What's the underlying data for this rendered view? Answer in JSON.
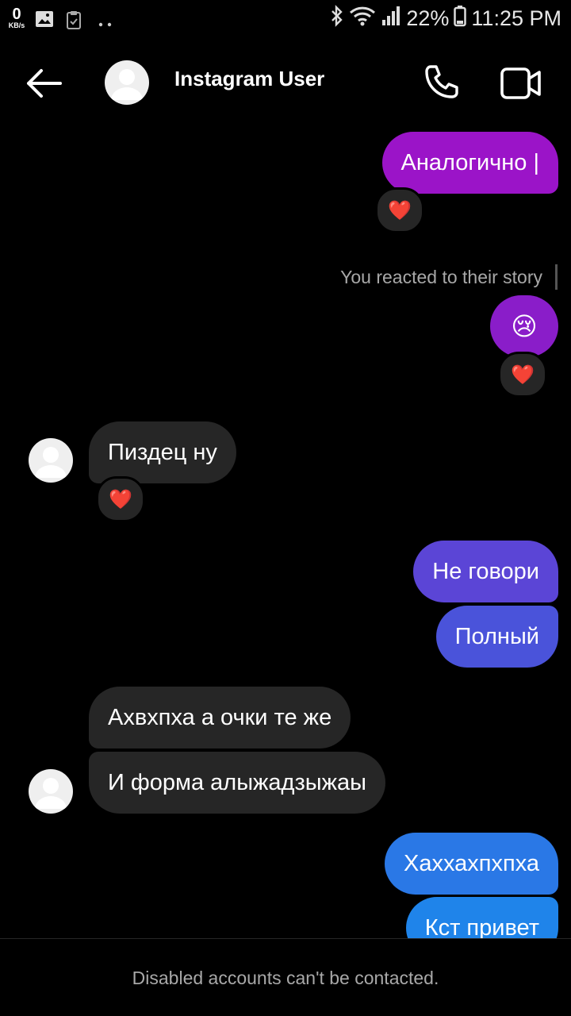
{
  "status_bar": {
    "net_speed": "0",
    "net_unit": "KB/s",
    "battery": "22%",
    "time": "11:25 PM",
    "icons": [
      "image-icon",
      "clipboard-icon",
      "dots-icon",
      "bluetooth-icon",
      "wifi-icon",
      "signal-icon",
      "battery-icon"
    ]
  },
  "header": {
    "title": "Instagram User",
    "icons": [
      "back-arrow-icon",
      "avatar",
      "phone-icon",
      "video-camera-icon"
    ]
  },
  "messages": [
    {
      "from": "me",
      "text": "Аналогично |",
      "color": "#9b14c8",
      "reaction": "❤️"
    },
    {
      "from": "system",
      "text": "You reacted to their story"
    },
    {
      "from": "me",
      "text": "😢",
      "color": "#8a1dc9",
      "reaction": "❤️"
    },
    {
      "from": "them",
      "text": "Пиздец ну",
      "reaction": "❤️"
    },
    {
      "from": "me",
      "text": "Не говори",
      "color": "#5b45d6"
    },
    {
      "from": "me",
      "text": "Полный",
      "color": "#4a53da"
    },
    {
      "from": "them",
      "text": "Ахвхпха а очки те же"
    },
    {
      "from": "them",
      "text": "И форма алыжадзыжаы"
    },
    {
      "from": "me",
      "text": "Хаххахпхпха",
      "color": "#2a78e6"
    },
    {
      "from": "me",
      "text": "Кст привет",
      "color": "#1f84ea"
    }
  ],
  "footer": {
    "text": "Disabled accounts can't be contacted."
  }
}
